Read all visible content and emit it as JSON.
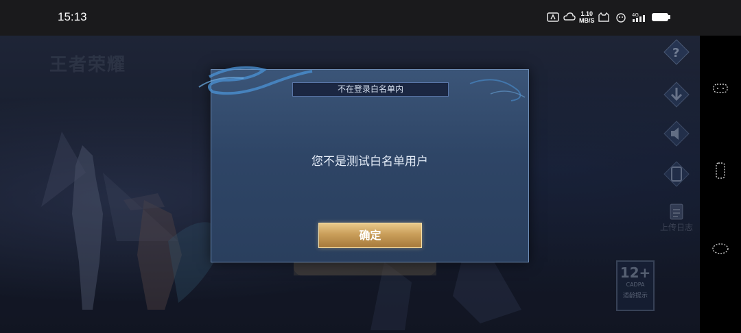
{
  "status_bar": {
    "time": "15:13",
    "net_speed_value": "1.10",
    "net_speed_unit": "MB/S",
    "network_label": "4G"
  },
  "dialog": {
    "title": "不在登录白名单内",
    "message": "您不是测试白名单用户",
    "confirm_label": "确定"
  },
  "side_panel": {
    "upload_log_label": "上传日志"
  },
  "age_rating": {
    "age": "12+",
    "org": "CADPA",
    "tip": "适龄提示"
  },
  "game_logo_text": "王者荣耀",
  "icons": {
    "help": "help-icon",
    "download": "download-icon",
    "sound": "sound-icon",
    "repair": "repair-icon",
    "upload_log": "upload-log-icon"
  },
  "colors": {
    "dialog_bg": "#2e4566",
    "confirm_gold": "#c99e5a",
    "title_box": "#1b2742"
  }
}
